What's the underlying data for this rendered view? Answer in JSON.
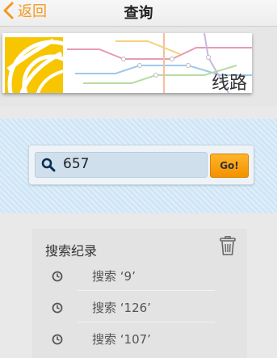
{
  "nav": {
    "back_label": "返回",
    "title": "查询"
  },
  "banner": {
    "label": "线路"
  },
  "search": {
    "value": "657",
    "go_label": "Go!"
  },
  "history": {
    "title": "搜索纪录",
    "items": [
      {
        "label": "搜索 ‘9’"
      },
      {
        "label": "搜索 ‘126’"
      },
      {
        "label": "搜索 ‘107’"
      }
    ]
  },
  "colors": {
    "accent": "#f39a1e",
    "go_button": "#f7a21a",
    "search_band": "#cfe6f6"
  }
}
